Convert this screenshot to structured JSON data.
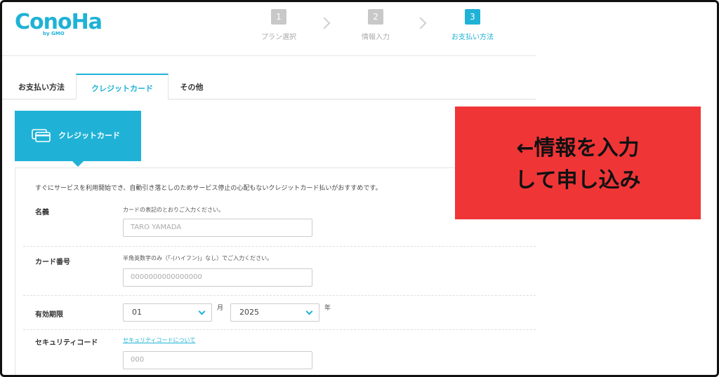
{
  "header": {
    "logo_text": "ConoHa",
    "logo_sub": "by GMO",
    "steps": [
      {
        "num": "1",
        "label": "プラン選択"
      },
      {
        "num": "2",
        "label": "情報入力"
      },
      {
        "num": "3",
        "label": "お支払い方法"
      }
    ],
    "active_step": 3
  },
  "tabs": {
    "label": "お支払い方法",
    "items": [
      "クレジットカード",
      "その他"
    ]
  },
  "card_section": {
    "title": "クレジットカード",
    "intro": "すぐにサービスを利用開始でき、自動引き落としのためサービス停止の心配もないクレジットカード払いがおすすめです。"
  },
  "form": {
    "name": {
      "label": "名義",
      "hint": "カードの表記のとおりご入力ください。",
      "placeholder": "TARO YAMADA"
    },
    "card_number": {
      "label": "カード番号",
      "hint": "半角英数字のみ（「-(ハイフン)」なし）でご入力ください。",
      "placeholder": "0000000000000000"
    },
    "expiry": {
      "label": "有効期限",
      "month": "01",
      "month_unit": "月",
      "year": "2025",
      "year_unit": "年"
    },
    "security_code": {
      "label": "セキュリティコード",
      "link": "セキュリティコードについて",
      "placeholder": "000"
    }
  },
  "callout": {
    "line1": "←情報を入力",
    "line2": "して申し込み"
  },
  "colors": {
    "accent": "#1fb2d6",
    "callout_bg": "#f03537"
  }
}
